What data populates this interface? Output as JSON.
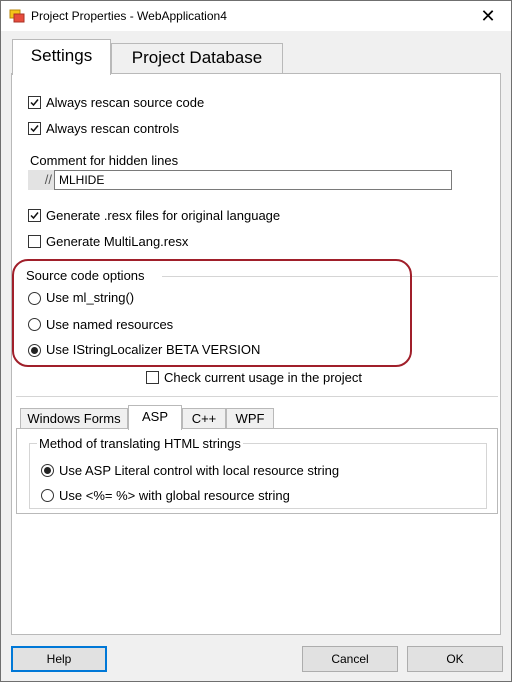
{
  "window": {
    "title": "Project Properties - WebApplication4",
    "close_label": "✕"
  },
  "main_tabs": [
    {
      "label": "Settings"
    },
    {
      "label": "Project Database"
    }
  ],
  "settings": {
    "always_rescan_source": {
      "label": "Always rescan source code",
      "checked": true
    },
    "always_rescan_controls": {
      "label": "Always rescan controls",
      "checked": true
    },
    "comment_hidden_lines": {
      "label": "Comment for hidden lines",
      "prefix": "//",
      "value": "MLHIDE"
    },
    "generate_resx": {
      "label": "Generate .resx files for original language",
      "checked": true
    },
    "generate_multilang": {
      "label": "Generate MultiLang.resx",
      "checked": false
    }
  },
  "source_code_options": {
    "group_label": "Source code options",
    "options": [
      {
        "label": "Use ml_string()",
        "selected": false
      },
      {
        "label": "Use named resources",
        "selected": false
      },
      {
        "label": "Use IStringLocalizer BETA VERSION",
        "selected": true
      }
    ]
  },
  "check_usage": {
    "label": "Check current usage in the project",
    "checked": false
  },
  "sub_tabs": [
    {
      "label": "Windows Forms"
    },
    {
      "label": "ASP"
    },
    {
      "label": "C++"
    },
    {
      "label": "WPF"
    }
  ],
  "html_strings": {
    "group_label": "Method of translating HTML strings",
    "options": [
      {
        "label": "Use ASP Literal control with local resource string",
        "selected": true
      },
      {
        "label": "Use <%= %> with global resource string",
        "selected": false
      }
    ]
  },
  "buttons": {
    "help": "Help",
    "cancel": "Cancel",
    "ok": "OK"
  },
  "colors": {
    "highlight": "#a01f2a",
    "default_button_border": "#0078d7"
  }
}
